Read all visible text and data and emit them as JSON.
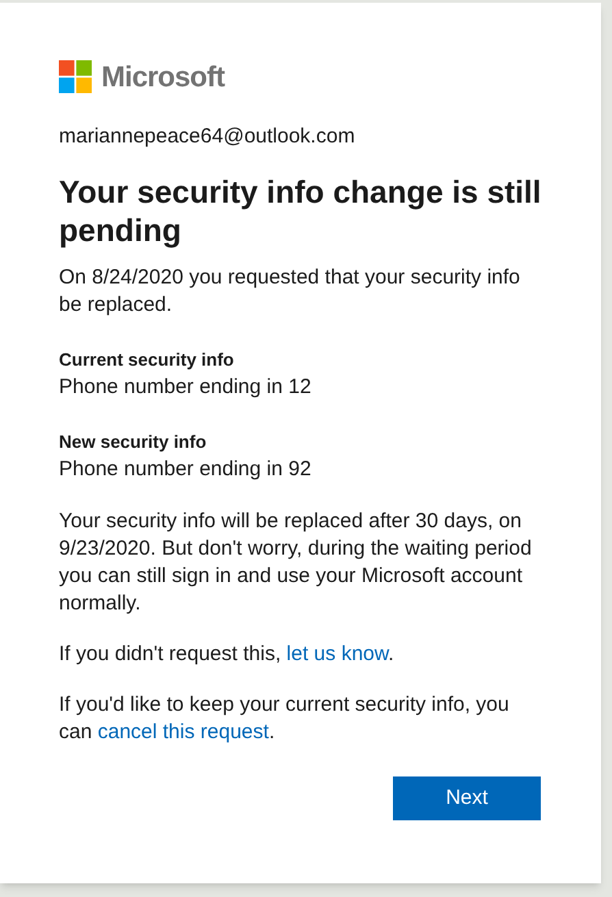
{
  "brand": "Microsoft",
  "account": "mariannepeace64@outlook.com",
  "title": "Your security info change is still pending",
  "intro": "On 8/24/2020 you requested that your security info be replaced.",
  "info": [
    {
      "label": "Current security info",
      "value": "Phone number ending in 12"
    },
    {
      "label": "New security info",
      "value": "Phone number ending in 92"
    }
  ],
  "notice": "Your security info will be replaced after 30 days, on 9/23/2020. But don't worry, during the waiting period you can still sign in and use your Microsoft account normally.",
  "link_paragraphs": [
    {
      "before": "If you didn't request this, ",
      "link": "let us know",
      "after": "."
    },
    {
      "before": "If you'd like to keep your current security info, you can ",
      "link": "cancel this request",
      "after": "."
    }
  ],
  "button": "Next"
}
